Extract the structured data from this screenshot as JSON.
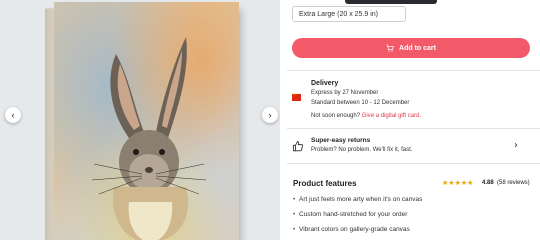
{
  "size_option": {
    "label": "Extra Large (20 x 25.9 in)"
  },
  "cart": {
    "label": "Add to cart"
  },
  "delivery": {
    "title": "Delivery",
    "express": "Express by 27 November",
    "standard": "Standard between 10 - 12 December",
    "not_soon_prefix": "Not soon enough?",
    "gift_card_link": "Give a digital gift card."
  },
  "returns": {
    "title": "Super-easy returns",
    "subtitle": "Problem? No problem. We'll fix it, fast."
  },
  "features": {
    "title": "Product features",
    "rating": "4.88",
    "reviews": "(58 reviews)",
    "star_count": 5,
    "items": [
      "Art just feels more arty when it's on canvas",
      "Custom hand-stretched for your order",
      "Vibrant colors on gallery-grade canvas"
    ]
  },
  "colors": {
    "accent": "#f25a6a",
    "link": "#e0394a",
    "star": "#f0a500"
  },
  "icons": {
    "prev": "chevron-left-icon",
    "next": "chevron-right-icon",
    "cart": "cart-icon",
    "flag": "china-flag-icon",
    "thumbs": "thumbs-up-icon"
  }
}
